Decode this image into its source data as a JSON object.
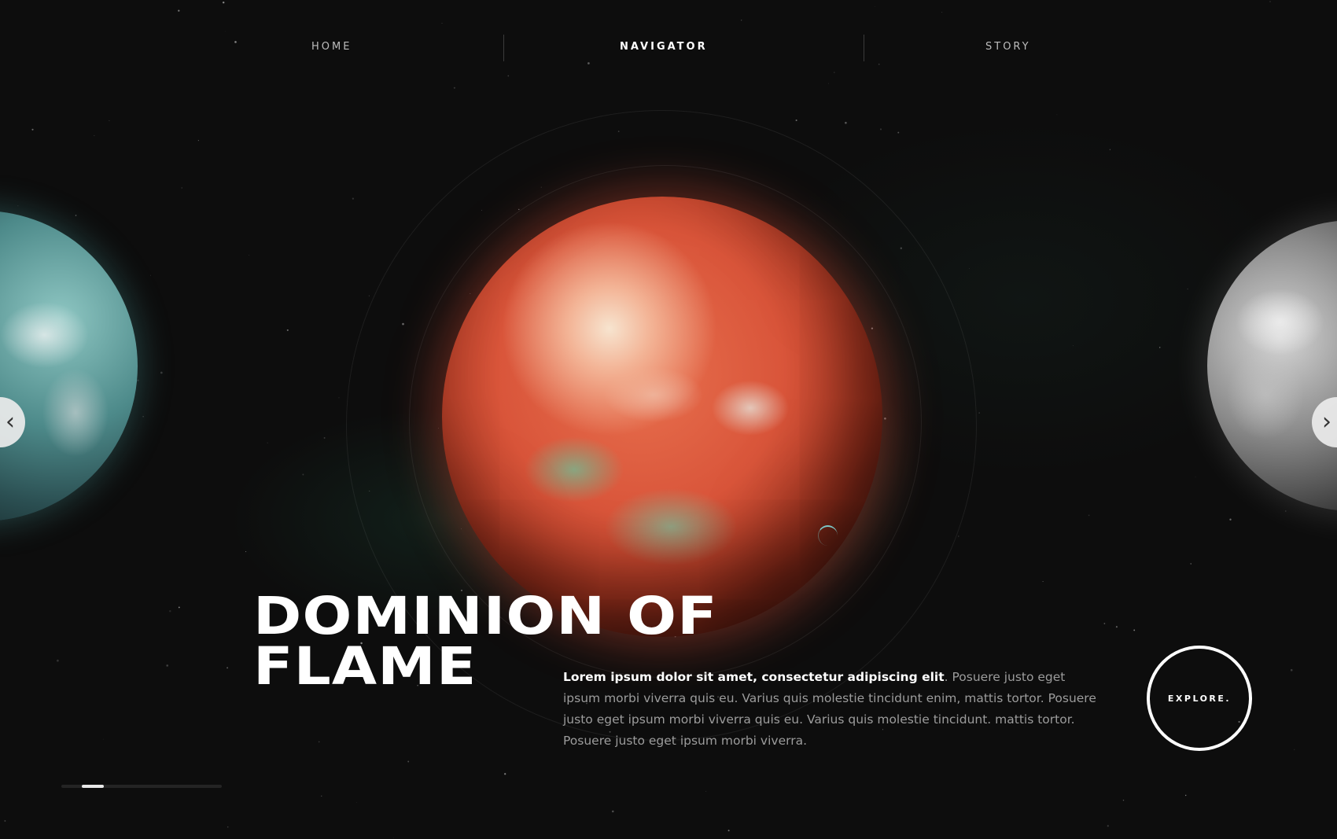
{
  "nav": {
    "items": [
      {
        "label": "HOME",
        "active": false
      },
      {
        "label": "NAVIGATOR",
        "active": true
      },
      {
        "label": "STORY",
        "active": false
      }
    ]
  },
  "hero": {
    "title_line1": "DOMINION OF",
    "title_line2": "FLAME",
    "description_bold": "Lorem ipsum dolor sit amet, consectetur adipiscing elit",
    "description_rest": ". Posuere justo eget ipsum morbi viverra quis eu. Varius quis molestie tincidunt enim, mattis tortor. Posuere justo eget ipsum morbi viverra quis eu. Varius quis molestie tincidunt.  mattis tortor. Posuere justo eget ipsum morbi viverra."
  },
  "explore_button": {
    "label": "EXPLORE."
  },
  "carousel": {
    "prev_icon": "chevron-left-icon",
    "next_icon": "chevron-right-icon",
    "current_slide": 2,
    "total_slides": 8
  },
  "colors": {
    "background": "#0d0d0d",
    "accent_planet": "#d9553a",
    "text_primary": "#ffffff",
    "text_secondary": "#9c9c9c"
  }
}
